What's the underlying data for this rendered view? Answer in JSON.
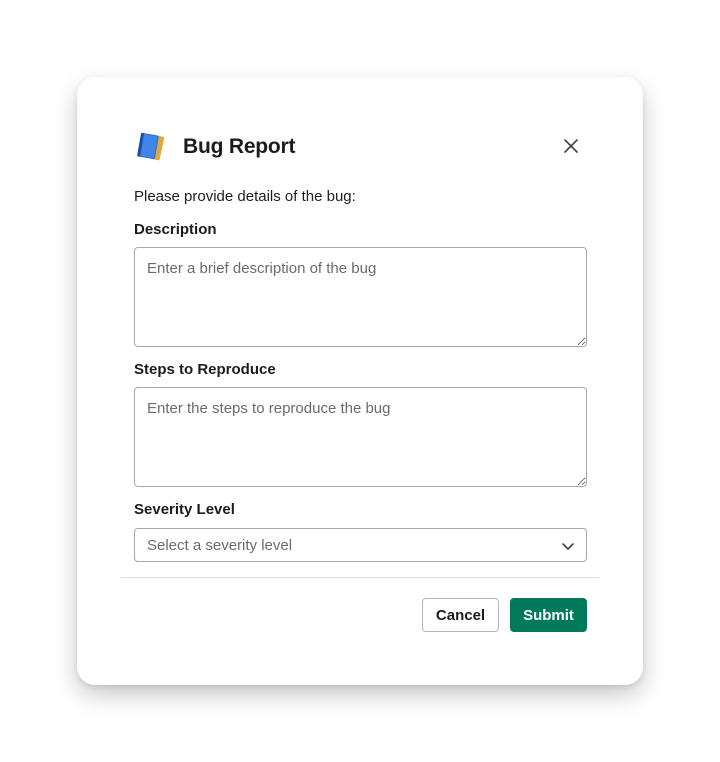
{
  "modal": {
    "title": "Bug Report",
    "icon": "notebook-icon",
    "close_icon": "close-icon",
    "intro": "Please provide details of the bug:"
  },
  "fields": {
    "description": {
      "label": "Description",
      "placeholder": "Enter a brief description of the bug",
      "value": ""
    },
    "steps": {
      "label": "Steps to Reproduce",
      "placeholder": "Enter the steps to reproduce the bug",
      "value": ""
    },
    "severity": {
      "label": "Severity Level",
      "placeholder": "Select a severity level",
      "icon": "chevron-down-icon"
    }
  },
  "actions": {
    "cancel_label": "Cancel",
    "submit_label": "Submit"
  },
  "colors": {
    "submit_bg": "#007a5a",
    "text": "#1d1c1d",
    "placeholder": "#6b6b6b",
    "border": "#a7a7a7"
  }
}
